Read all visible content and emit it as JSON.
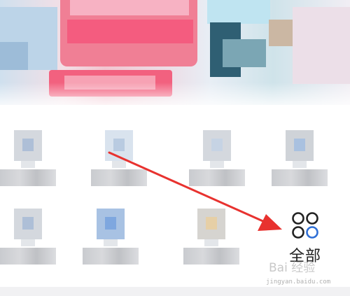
{
  "grid": {
    "items": [
      {
        "label": ""
      },
      {
        "label": ""
      },
      {
        "label": ""
      },
      {
        "label": ""
      },
      {
        "label": ""
      },
      {
        "label": ""
      },
      {
        "label": ""
      }
    ],
    "all_button": {
      "label": "全部",
      "icon": "grid-four-circles-icon"
    }
  },
  "annotation": {
    "arrow_color": "#e8322f"
  },
  "watermark": {
    "brand": "Bai 经验",
    "url": "jingyan.baidu.com"
  },
  "colors": {
    "accent_pink": "#f45c7f",
    "icon_blue": "#2f6fd6",
    "icon_dark": "#222222"
  }
}
